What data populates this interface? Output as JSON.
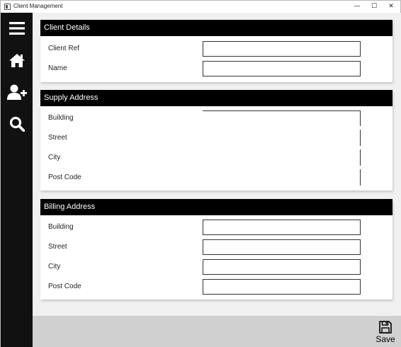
{
  "window": {
    "title": "Client Management",
    "controls": {
      "minimize": "—",
      "maximize": "☐",
      "close": "✕"
    }
  },
  "sidebar": {
    "items": [
      {
        "name": "menu",
        "icon": "hamburger-menu-icon"
      },
      {
        "name": "home",
        "icon": "home-icon"
      },
      {
        "name": "add-client",
        "icon": "add-user-icon"
      },
      {
        "name": "search",
        "icon": "search-icon"
      }
    ]
  },
  "client_details": {
    "header": "Client Details",
    "client_ref_label": "Client Ref",
    "client_ref_value": "",
    "name_label": "Name",
    "name_value": ""
  },
  "supply_address": {
    "header": "Supply Address",
    "building_label": "Building",
    "street_label": "Street",
    "city_label": "City",
    "post_code_label": "Post Code",
    "building_value": "",
    "street_value": "",
    "city_value": "",
    "post_code_value": ""
  },
  "billing_address": {
    "header": "Billing Address",
    "building_label": "Building",
    "street_label": "Street",
    "city_label": "City",
    "post_code_label": "Post Code",
    "building_value": "",
    "street_value": "",
    "city_value": "",
    "post_code_value": ""
  },
  "footer": {
    "save_label": "Save",
    "save_icon": "floppy-disk-icon"
  },
  "colors": {
    "sidebar": "#111111",
    "section_header": "#000000",
    "background": "#f0f0f0",
    "footer": "#d0d0d0"
  }
}
